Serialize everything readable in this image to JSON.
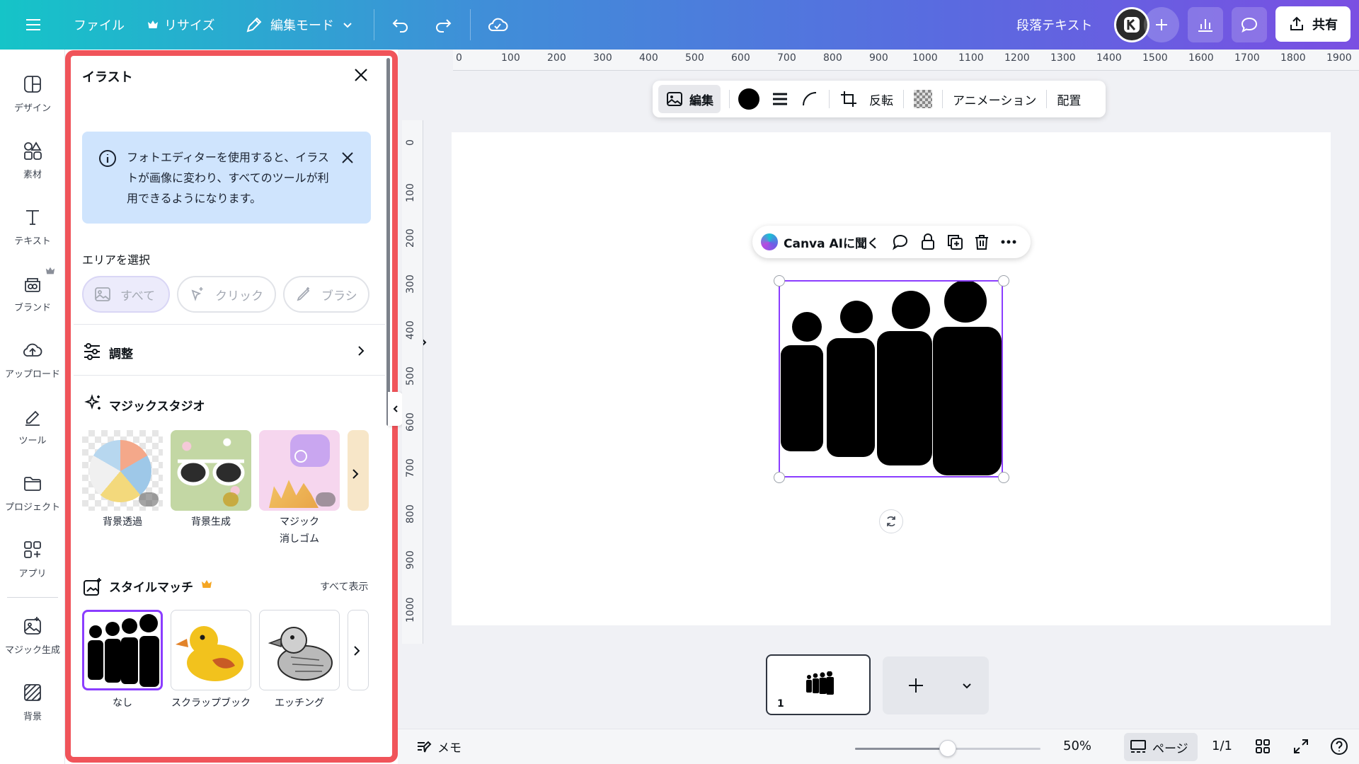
{
  "topbar": {
    "file": "ファイル",
    "resize": "リサイズ",
    "edit_mode": "編集モード",
    "text_style": "段落テキスト",
    "share": "共有"
  },
  "rail": {
    "items": [
      {
        "label": "デザイン",
        "icon": "design-icon"
      },
      {
        "label": "素材",
        "icon": "elements-icon"
      },
      {
        "label": "テキスト",
        "icon": "text-icon"
      },
      {
        "label": "ブランド",
        "icon": "brand-icon"
      },
      {
        "label": "アップロード",
        "icon": "upload-icon"
      },
      {
        "label": "ツール",
        "icon": "tools-icon"
      },
      {
        "label": "プロジェクト",
        "icon": "folder-icon"
      },
      {
        "label": "アプリ",
        "icon": "apps-icon"
      },
      {
        "label": "マジック生成",
        "icon": "magic-media-icon"
      },
      {
        "label": "背景",
        "icon": "background-icon"
      }
    ]
  },
  "panel": {
    "title": "イラスト",
    "info": "フォトエディターを使用すると、イラストが画像に変わり、すべてのツールが利用できるようになります。",
    "select_area": "エリアを選択",
    "pills": [
      "すべて",
      "クリック",
      "ブラシ"
    ],
    "adjust": "調整",
    "magic_studio": "マジックスタジオ",
    "magic_items": [
      {
        "label": "背景透過"
      },
      {
        "label": "背景生成"
      },
      {
        "label": "マジック\n消しゴム"
      }
    ],
    "style_match": "スタイルマッチ",
    "show_all": "すべて表示",
    "styles": [
      {
        "label": "なし"
      },
      {
        "label": "スクラップブック"
      },
      {
        "label": "エッチング"
      }
    ]
  },
  "ruler": {
    "h": [
      "0",
      "100",
      "200",
      "300",
      "400",
      "500",
      "600",
      "700",
      "800",
      "900",
      "1000",
      "1100",
      "1200",
      "1300",
      "1400",
      "1500",
      "1600",
      "1700",
      "1800",
      "1900"
    ],
    "v": [
      "0",
      "100",
      "200",
      "300",
      "400",
      "500",
      "600",
      "700",
      "800",
      "900",
      "1000"
    ]
  },
  "context_toolbar": {
    "edit": "編集",
    "flip": "反転",
    "animate": "アニメーション",
    "position": "配置"
  },
  "ai_bar": {
    "ask": "Canva AIに聞く"
  },
  "pages": {
    "page_number": "1"
  },
  "footer": {
    "notes": "メモ",
    "zoom": "50%",
    "zoom_fraction": 0.5,
    "pages": "ページ",
    "page_count": "1/1"
  }
}
